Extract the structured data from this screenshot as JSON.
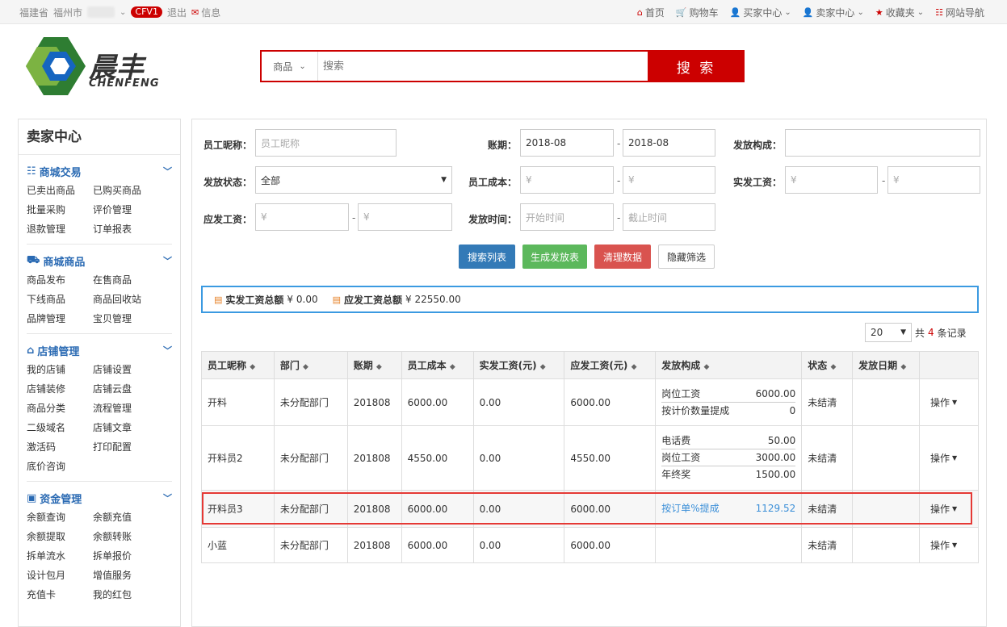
{
  "topbar": {
    "province": "福建省",
    "city": "福州市",
    "level_badge": "CFV1",
    "logout": "退出",
    "message": "信息",
    "nav": [
      {
        "icon": "home-icon",
        "label": "首页",
        "dropdown": false
      },
      {
        "icon": "cart-icon",
        "label": "购物车",
        "dropdown": false
      },
      {
        "icon": "user-icon",
        "label": "买家中心",
        "dropdown": true
      },
      {
        "icon": "user-icon",
        "label": "卖家中心",
        "dropdown": true
      },
      {
        "icon": "star-icon",
        "label": "收藏夹",
        "dropdown": true
      },
      {
        "icon": "list-icon",
        "label": "网站导航",
        "dropdown": false
      }
    ]
  },
  "logo": {
    "cn": "晨丰",
    "en": "CHENFENG"
  },
  "search": {
    "category": "商品",
    "placeholder": "搜索",
    "button": "搜 索"
  },
  "sidebar": {
    "title": "卖家中心",
    "groups": [
      {
        "icon": "list-icon",
        "title": "商城交易",
        "items": [
          "已卖出商品",
          "已购买商品",
          "批量采购",
          "评价管理",
          "退款管理",
          "订单报表"
        ]
      },
      {
        "icon": "truck-icon",
        "title": "商城商品",
        "items": [
          "商品发布",
          "在售商品",
          "下线商品",
          "商品回收站",
          "品牌管理",
          "宝贝管理"
        ]
      },
      {
        "icon": "home-icon",
        "title": "店铺管理",
        "items": [
          "我的店铺",
          "店铺设置",
          "店铺装修",
          "店铺云盘",
          "商品分类",
          "流程管理",
          "二级域名",
          "店铺文章",
          "激活码",
          "打印配置",
          "底价咨询"
        ]
      },
      {
        "icon": "money-icon",
        "title": "资金管理",
        "items": [
          "余额查询",
          "余额充值",
          "余额提取",
          "余额转账",
          "拆单流水",
          "拆单报价",
          "设计包月",
          "增值服务",
          "充值卡",
          "我的红包"
        ]
      }
    ]
  },
  "filters": {
    "nickname_label": "员工昵称：",
    "nickname_placeholder": "员工昵称",
    "period_label": "账期：",
    "period_from": "2018-08",
    "period_to": "2018-08",
    "composition_label": "发放构成：",
    "status_label": "发放状态：",
    "status_value": "全部",
    "cost_label": "员工成本：",
    "actual_label": "实发工资：",
    "payable_label": "应发工资：",
    "time_label": "发放时间：",
    "time_from_placeholder": "开始时间",
    "time_to_placeholder": "截止时间",
    "currency_placeholder": "¥",
    "dash": "-"
  },
  "buttons": {
    "search": "搜索列表",
    "generate": "生成发放表",
    "clear": "清理数据",
    "hide": "隐藏筛选"
  },
  "buttons_colors": {
    "search": "#337ab7",
    "generate": "#5cb85c",
    "clear": "#d9534f"
  },
  "summary": {
    "actual_label": "实发工资总额",
    "actual_value": "¥ 0.00",
    "payable_label": "应发工资总额",
    "payable_value": "¥ 22550.00"
  },
  "pager": {
    "page_size": "20",
    "prefix": "共",
    "count": "4",
    "suffix": "条记录"
  },
  "table": {
    "headers": [
      "员工昵称",
      "部门",
      "账期",
      "员工成本",
      "实发工资(元)",
      "应发工资(元)",
      "发放构成",
      "状态",
      "发放日期",
      ""
    ],
    "op_label": "操作",
    "rows": [
      {
        "name": "开料",
        "dept": "未分配部门",
        "period": "201808",
        "cost": "6000.00",
        "actual": "0.00",
        "payable": "6000.00",
        "composition": [
          {
            "k": "岗位工资",
            "v": "6000.00"
          },
          {
            "k": "按计价数量提成",
            "v": "0"
          }
        ],
        "status": "未结清",
        "date": ""
      },
      {
        "name": "开料员2",
        "dept": "未分配部门",
        "period": "201808",
        "cost": "4550.00",
        "actual": "0.00",
        "payable": "4550.00",
        "composition": [
          {
            "k": "电话费",
            "v": "50.00"
          },
          {
            "k": "岗位工资",
            "v": "3000.00"
          },
          {
            "k": "年终奖",
            "v": "1500.00"
          }
        ],
        "status": "未结清",
        "date": ""
      },
      {
        "name": "开料员3",
        "dept": "未分配部门",
        "period": "201808",
        "cost": "6000.00",
        "actual": "0.00",
        "payable": "6000.00",
        "composition": [
          {
            "k": "按订单%提成",
            "v": "1129.52"
          }
        ],
        "status": "未结清",
        "date": "",
        "highlight": true
      },
      {
        "name": "小蓝",
        "dept": "未分配部门",
        "period": "201808",
        "cost": "6000.00",
        "actual": "0.00",
        "payable": "6000.00",
        "composition": [],
        "status": "未结清",
        "date": ""
      }
    ]
  }
}
